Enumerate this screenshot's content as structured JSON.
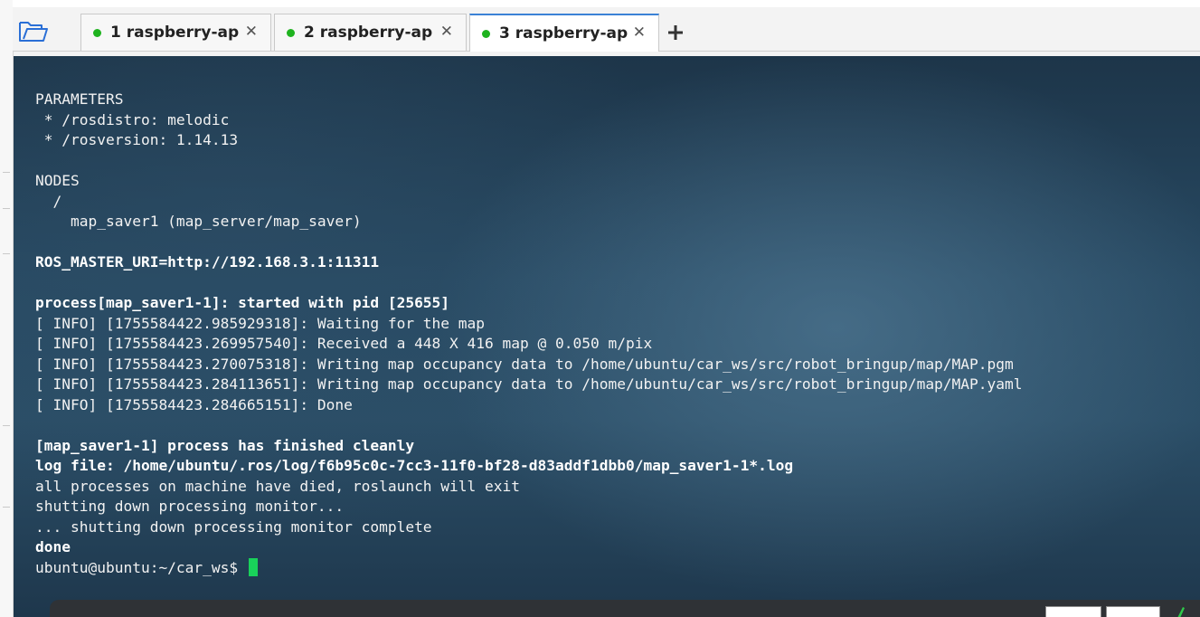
{
  "tabs": [
    {
      "label": "1 raspberry-ap",
      "close": "✕",
      "status_color": "#1fb31f"
    },
    {
      "label": "2 raspberry-ap",
      "close": "✕",
      "status_color": "#1fb31f"
    },
    {
      "label": "3 raspberry-ap",
      "close": "✕",
      "status_color": "#1fb31f",
      "active": true
    }
  ],
  "new_tab_label": "+",
  "terminal": {
    "lines": [
      "PARAMETERS",
      " * /rosdistro: melodic",
      " * /rosversion: 1.14.13",
      "",
      "NODES",
      "  /",
      "    map_saver1 (map_server/map_saver)",
      "",
      "ROS_MASTER_URI=http://192.168.3.1:11311",
      "",
      "process[map_saver1-1]: started with pid [25655]",
      "[ INFO] [1755584422.985929318]: Waiting for the map",
      "[ INFO] [1755584423.269957540]: Received a 448 X 416 map @ 0.050 m/pix",
      "[ INFO] [1755584423.270075318]: Writing map occupancy data to /home/ubuntu/car_ws/src/robot_bringup/map/MAP.pgm",
      "[ INFO] [1755584423.284113651]: Writing map occupancy data to /home/ubuntu/car_ws/src/robot_bringup/map/MAP.yaml",
      "[ INFO] [1755584423.284665151]: Done",
      "",
      "[map_saver1-1] process has finished cleanly",
      "log file: /home/ubuntu/.ros/log/f6b95c0c-7cc3-11f0-bf28-d83addf1dbb0/map_saver1-1*.log",
      "all processes on machine have died, roslaunch will exit",
      "shutting down processing monitor...",
      "... shutting down processing monitor complete",
      "done"
    ],
    "bold_lines": [
      8,
      10,
      17,
      18,
      22
    ],
    "prompt": "ubuntu@ubuntu:~/car_ws$ ",
    "cursor_color": "#19d15a"
  },
  "colors": {
    "accent": "#3b82d6",
    "status_green": "#1fb31f"
  },
  "icons": {
    "folder": "folder-open-icon",
    "new_tab": "plus-icon",
    "close": "close-icon"
  }
}
